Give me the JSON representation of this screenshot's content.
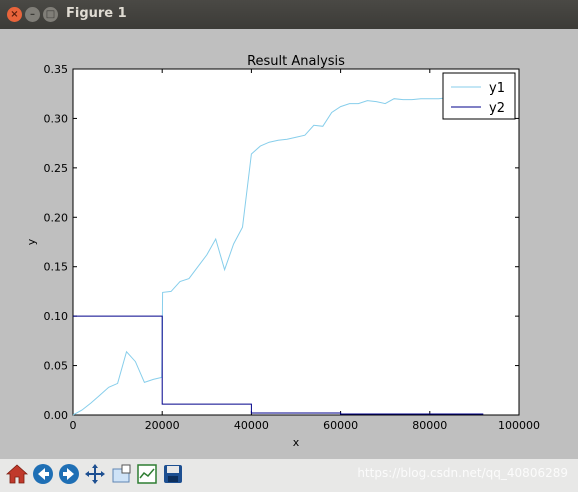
{
  "window": {
    "title": "Figure 1",
    "close_glyph": "×",
    "min_glyph": "–",
    "max_glyph": "□"
  },
  "toolbar": {
    "buttons": [
      "home-icon",
      "back-icon",
      "forward-icon",
      "pan-icon",
      "zoom-icon",
      "configure-subplots-icon",
      "save-icon"
    ],
    "watermark": "https://blog.csdn.net/qq_40806289"
  },
  "colors": {
    "y1": "#87ceeb",
    "y2": "#00008b",
    "canvas_bg": "#bfbfbf"
  },
  "chart_data": {
    "type": "line",
    "title": "Result Analysis",
    "xlabel": "x",
    "ylabel": "y",
    "xlim": [
      0,
      100000
    ],
    "ylim": [
      0,
      0.35
    ],
    "xticks": [
      "0",
      "20000",
      "40000",
      "60000",
      "80000",
      "100000"
    ],
    "yticks": [
      "0.00",
      "0.05",
      "0.10",
      "0.15",
      "0.20",
      "0.25",
      "0.30",
      "0.35"
    ],
    "legend": "top-right",
    "series": [
      {
        "name": "y1",
        "x": [
          0,
          2000,
          4000,
          6000,
          8000,
          10000,
          12000,
          14000,
          16000,
          18000,
          19900,
          20100,
          22000,
          24000,
          26000,
          28000,
          30000,
          32000,
          34000,
          36000,
          38000,
          40000,
          42000,
          44000,
          46000,
          48000,
          50000,
          52000,
          54000,
          56000,
          58000,
          60000,
          62000,
          64000,
          66000,
          68000,
          70000,
          72000,
          74000,
          76000,
          78000,
          80000,
          82000,
          84000,
          86000,
          88000,
          90000,
          92000
        ],
        "y": [
          0.0,
          0.005,
          0.012,
          0.02,
          0.028,
          0.032,
          0.064,
          0.054,
          0.033,
          0.036,
          0.038,
          0.124,
          0.125,
          0.135,
          0.138,
          0.15,
          0.162,
          0.178,
          0.147,
          0.173,
          0.19,
          0.264,
          0.272,
          0.276,
          0.278,
          0.279,
          0.281,
          0.283,
          0.293,
          0.292,
          0.306,
          0.312,
          0.315,
          0.315,
          0.318,
          0.317,
          0.315,
          0.32,
          0.319,
          0.319,
          0.32,
          0.32,
          0.32,
          0.321,
          0.321,
          0.321,
          0.321,
          0.321
        ]
      },
      {
        "name": "y2",
        "x": [
          0,
          20000,
          20000,
          40000,
          40000,
          60000,
          60000,
          92000
        ],
        "y": [
          0.1,
          0.1,
          0.011,
          0.011,
          0.002,
          0.002,
          0.001,
          0.001
        ]
      }
    ]
  }
}
